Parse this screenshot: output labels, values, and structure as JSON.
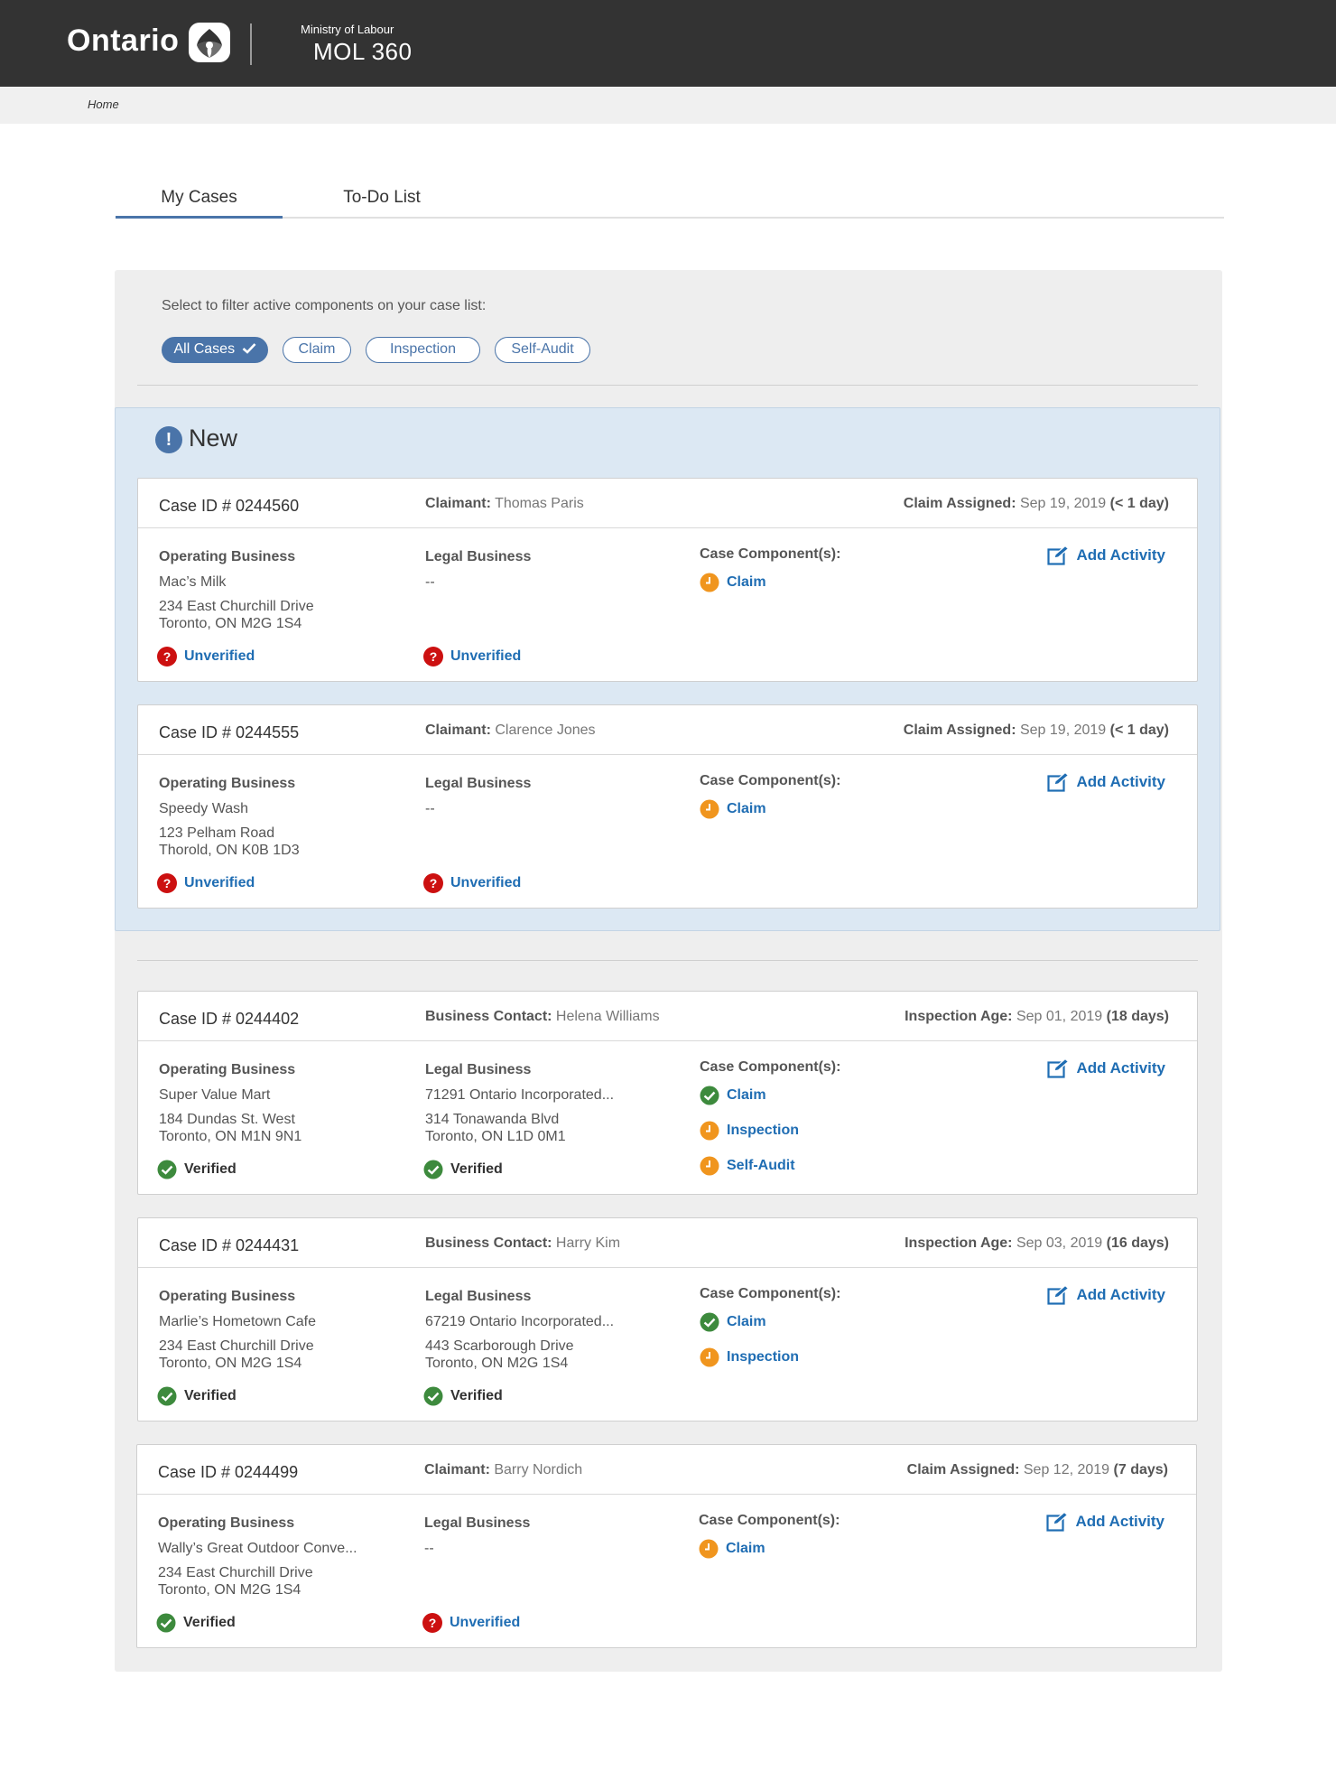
{
  "header": {
    "logo_text": "Ontario",
    "ministry": "Ministry of Labour",
    "app_name": "MOL 360"
  },
  "breadcrumb": "Home",
  "tabs": [
    {
      "label": "My Cases",
      "active": true
    },
    {
      "label": "To-Do List",
      "active": false
    }
  ],
  "filter": {
    "label": "Select to filter active components on your case list:",
    "pills": [
      {
        "label": "All Cases",
        "active": true
      },
      {
        "label": "Claim",
        "active": false
      },
      {
        "label": "Inspection",
        "active": false
      },
      {
        "label": "Self-Audit",
        "active": false
      }
    ]
  },
  "new_section": {
    "title": "New"
  },
  "labels": {
    "operating_business": "Operating Business",
    "legal_business": "Legal Business",
    "case_components": "Case Component(s):",
    "add_activity": "Add Activity"
  },
  "cases": [
    {
      "case_id": "Case ID # 0244560",
      "contact_label": "Claimant:",
      "contact_name": "Thomas Paris",
      "date_label": "Claim Assigned:",
      "date": "Sep 19, 2019",
      "age": "(< 1 day)",
      "operating": {
        "name": "Mac’s Milk",
        "address1": "234 East Churchill Drive",
        "address2": "Toronto, ON M2G 1S4",
        "status": "Unverified"
      },
      "legal": {
        "name": "--",
        "address1": "",
        "address2": "",
        "status": "Unverified"
      },
      "components": [
        {
          "label": "Claim",
          "state": "pending"
        }
      ]
    },
    {
      "case_id": "Case ID # 0244555",
      "contact_label": "Claimant:",
      "contact_name": "Clarence Jones",
      "date_label": "Claim Assigned:",
      "date": "Sep 19, 2019",
      "age": "(< 1 day)",
      "operating": {
        "name": "Speedy Wash",
        "address1": "123 Pelham Road",
        "address2": "Thorold, ON K0B 1D3",
        "status": "Unverified"
      },
      "legal": {
        "name": "--",
        "address1": "",
        "address2": "",
        "status": "Unverified"
      },
      "components": [
        {
          "label": "Claim",
          "state": "pending"
        }
      ]
    },
    {
      "case_id": "Case ID # 0244402",
      "contact_label": "Business Contact:",
      "contact_name": "Helena Williams",
      "date_label": "Inspection Age:",
      "date": "Sep 01, 2019",
      "age": "(18 days)",
      "operating": {
        "name": "Super Value Mart",
        "address1": "184 Dundas St. West",
        "address2": "Toronto, ON M1N 9N1",
        "status": "Verified"
      },
      "legal": {
        "name": "71291 Ontario Incorporated...",
        "address1": "314 Tonawanda Blvd",
        "address2": "Toronto, ON L1D 0M1",
        "status": "Verified"
      },
      "components": [
        {
          "label": "Claim",
          "state": "complete"
        },
        {
          "label": "Inspection",
          "state": "pending"
        },
        {
          "label": "Self-Audit",
          "state": "pending"
        }
      ]
    },
    {
      "case_id": "Case ID # 0244431",
      "contact_label": "Business Contact:",
      "contact_name": "Harry Kim",
      "date_label": "Inspection Age:",
      "date": "Sep 03, 2019",
      "age": "(16 days)",
      "operating": {
        "name": "Marlie’s Hometown Cafe",
        "address1": "234 East Churchill Drive",
        "address2": "Toronto, ON M2G 1S4",
        "status": "Verified"
      },
      "legal": {
        "name": "67219 Ontario Incorporated...",
        "address1": "443 Scarborough Drive",
        "address2": "Toronto, ON M2G 1S4",
        "status": "Verified"
      },
      "components": [
        {
          "label": "Claim",
          "state": "complete"
        },
        {
          "label": "Inspection",
          "state": "pending"
        }
      ]
    },
    {
      "case_id": "Case ID # 0244499",
      "contact_label": "Claimant:",
      "contact_name": "Barry Nordich",
      "date_label": "Claim Assigned:",
      "date": "Sep 12, 2019",
      "age": "(7 days)",
      "operating": {
        "name": "Wally’s Great Outdoor Conve...",
        "address1": "234 East Churchill Drive",
        "address2": "Toronto, ON M2G 1S4",
        "status": "Verified"
      },
      "legal": {
        "name": "--",
        "address1": "",
        "address2": "",
        "status": "Unverified"
      },
      "components": [
        {
          "label": "Claim",
          "state": "pending"
        }
      ]
    }
  ],
  "colors": {
    "header_bg": "#333333",
    "accent_blue": "#4a74a9",
    "link_blue": "#1f6db3",
    "new_section_bg": "#dce8f3",
    "unverified_red": "#cc1010",
    "verified_green": "#3d8a3d",
    "pending_orange": "#f0951e"
  },
  "icons": {
    "logo": "trillium-icon",
    "new": "exclamation-icon",
    "add_activity": "edit-icon",
    "unverified": "question-icon",
    "verified": "check-circle-icon",
    "pending": "clock-icon",
    "complete": "check-circle-icon",
    "filter_active": "check-icon"
  }
}
